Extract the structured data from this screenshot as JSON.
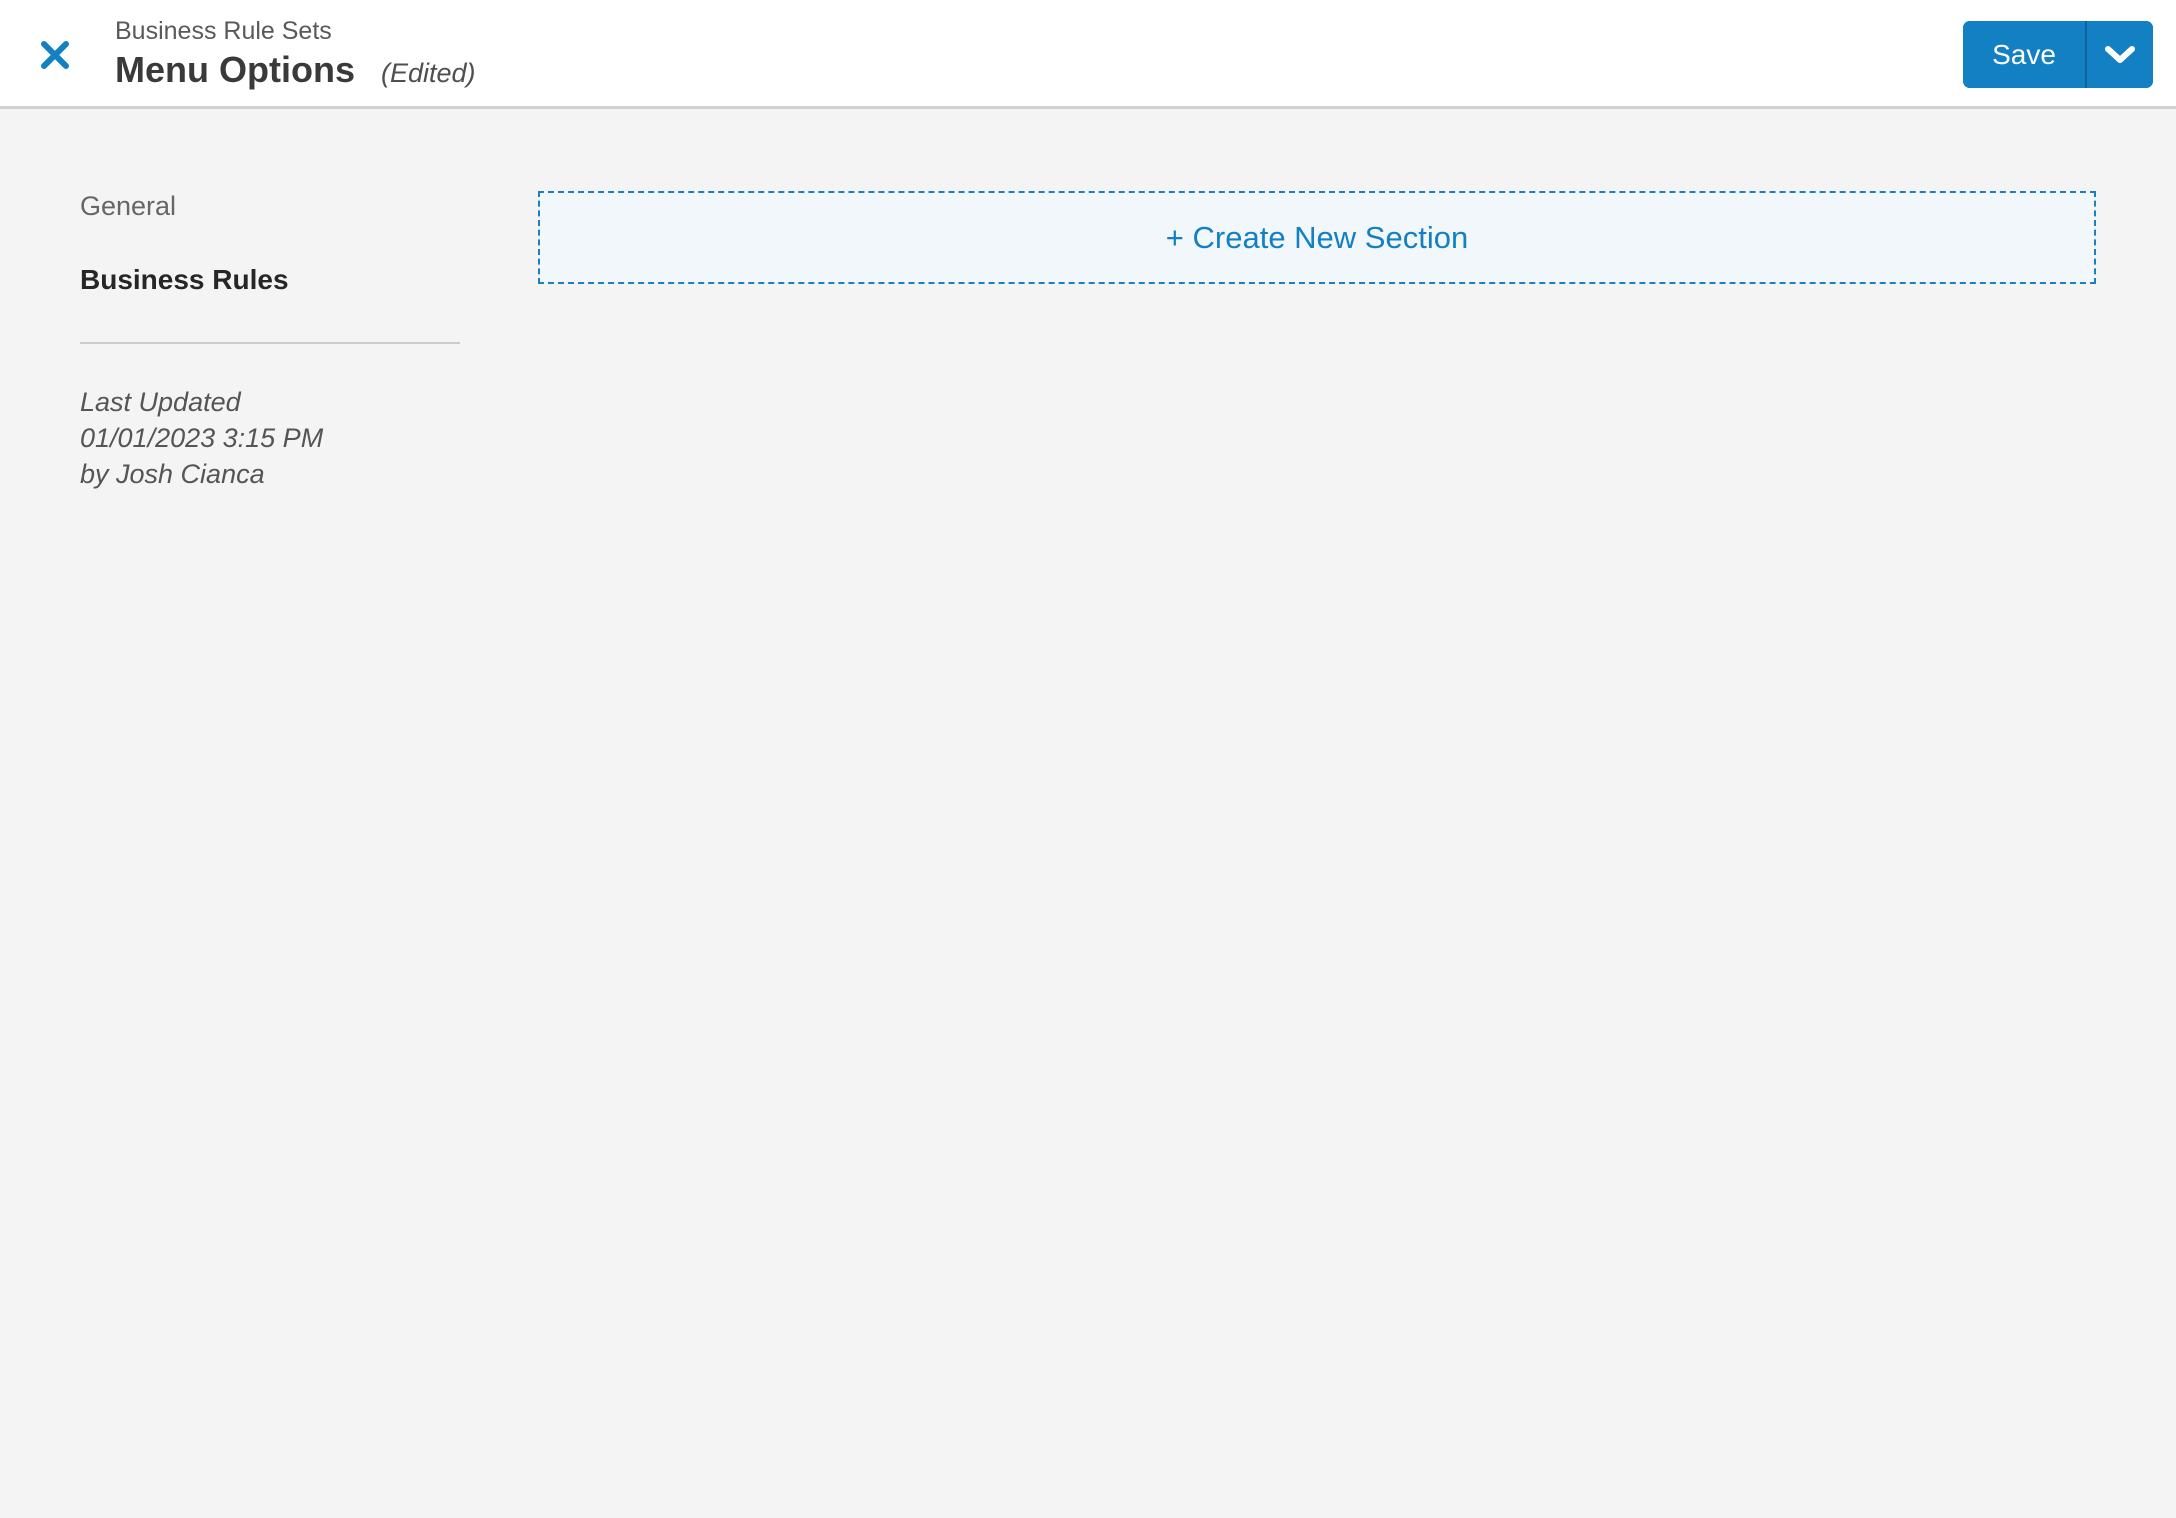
{
  "header": {
    "breadcrumb": "Business Rule Sets",
    "title": "Menu Options",
    "edited_badge": "(Edited)",
    "save_label": "Save"
  },
  "sidebar": {
    "items": [
      {
        "label": "General"
      },
      {
        "label": "Business Rules"
      }
    ],
    "meta": {
      "line1": "Last Updated",
      "line2": "01/01/2023 3:15 PM",
      "line3": "by Josh Cianca"
    }
  },
  "main": {
    "create_section_label": "+ Create New Section"
  },
  "icons": {
    "close": "close-icon",
    "save_chevron": "chevron-down-icon"
  },
  "colors": {
    "accent_blue": "#1380c3",
    "accent_blue_dark": "#0e629a",
    "page_bg": "#f4f4f4",
    "header_bg": "#ffffff",
    "header_border": "#d1d1d1",
    "dashed_box_bg": "#f2f7fb",
    "dashed_box_border": "#1a80c4"
  }
}
